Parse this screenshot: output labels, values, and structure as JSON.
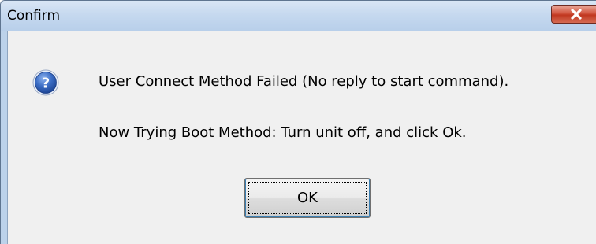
{
  "dialog": {
    "title": "Confirm",
    "close_icon": "close-icon",
    "icon": "question-icon",
    "message_line1": "User Connect Method Failed (No reply to start command).",
    "message_line2": "Now Trying Boot Method: Turn unit off, and click Ok.",
    "ok_label": "OK"
  },
  "colors": {
    "titlebar": "#c6d9ef",
    "client_background": "#f0f0f0",
    "close_button": "#c0371f",
    "question_icon": "#2f5fb3"
  }
}
